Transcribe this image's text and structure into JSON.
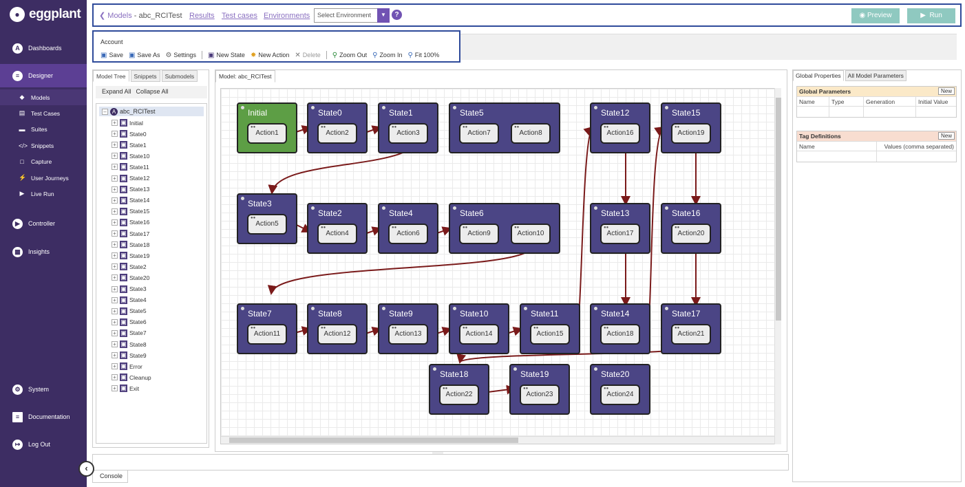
{
  "brand": {
    "name": "eggplant"
  },
  "nav": {
    "main": [
      {
        "label": "Dashboards",
        "icon": "dashboard-icon"
      },
      {
        "label": "Designer",
        "icon": "designer-icon"
      },
      {
        "label": "Controller",
        "icon": "controller-icon"
      },
      {
        "label": "Insights",
        "icon": "insights-icon"
      }
    ],
    "sub": [
      {
        "label": "Models",
        "icon": "models-icon"
      },
      {
        "label": "Test Cases",
        "icon": "test-cases-icon"
      },
      {
        "label": "Suites",
        "icon": "suites-icon"
      },
      {
        "label": "Snippets",
        "icon": "snippets-icon"
      },
      {
        "label": "Capture",
        "icon": "capture-icon"
      },
      {
        "label": "User Journeys",
        "icon": "user-journeys-icon"
      },
      {
        "label": "Live Run",
        "icon": "live-run-icon"
      }
    ],
    "bottom": [
      {
        "label": "System",
        "icon": "system-icon"
      },
      {
        "label": "Documentation",
        "icon": "documentation-icon"
      },
      {
        "label": "Log Out",
        "icon": "logout-icon"
      }
    ]
  },
  "topbar": {
    "crumb_parent": "Models",
    "crumb_sep": " - ",
    "crumb_current": "abc_RCITest",
    "links": [
      "Results",
      "Test cases",
      "Environments"
    ],
    "env_placeholder": "Select Environment",
    "preview_label": "Preview",
    "run_label": "Run"
  },
  "toolbar": {
    "account": "Account",
    "save": "Save",
    "save_as": "Save As",
    "settings": "Settings",
    "new_state": "New State",
    "new_action": "New Action",
    "delete": "Delete",
    "zoom_out": "Zoom Out",
    "zoom_in": "Zoom In",
    "fit": "Fit 100%"
  },
  "left_panel": {
    "tabs": [
      "Model Tree",
      "Snippets",
      "Submodels"
    ],
    "expand_all": "Expand All",
    "collapse_all": "Collapse All",
    "root": "abc_RCITest",
    "nodes": [
      "Initial",
      "State0",
      "State1",
      "State10",
      "State11",
      "State12",
      "State13",
      "State14",
      "State15",
      "State16",
      "State17",
      "State18",
      "State19",
      "State2",
      "State20",
      "State3",
      "State4",
      "State5",
      "State6",
      "State7",
      "State8",
      "State9",
      "Error",
      "Cleanup",
      "Exit"
    ]
  },
  "canvas": {
    "tab": "Model: abc_RCITest",
    "states": [
      {
        "name": "Initial",
        "actions": [
          "Action1"
        ],
        "kind": "initial"
      },
      {
        "name": "State0",
        "actions": [
          "Action2"
        ]
      },
      {
        "name": "State1",
        "actions": [
          "Action3"
        ]
      },
      {
        "name": "State5",
        "actions": [
          "Action7",
          "Action8"
        ]
      },
      {
        "name": "State12",
        "actions": [
          "Action16"
        ]
      },
      {
        "name": "State15",
        "actions": [
          "Action19"
        ]
      },
      {
        "name": "State3",
        "actions": [
          "Action5"
        ]
      },
      {
        "name": "State2",
        "actions": [
          "Action4"
        ]
      },
      {
        "name": "State4",
        "actions": [
          "Action6"
        ]
      },
      {
        "name": "State6",
        "actions": [
          "Action9",
          "Action10"
        ]
      },
      {
        "name": "State13",
        "actions": [
          "Action17"
        ]
      },
      {
        "name": "State16",
        "actions": [
          "Action20"
        ]
      },
      {
        "name": "State7",
        "actions": [
          "Action11"
        ]
      },
      {
        "name": "State8",
        "actions": [
          "Action12"
        ]
      },
      {
        "name": "State9",
        "actions": [
          "Action13"
        ]
      },
      {
        "name": "State10",
        "actions": [
          "Action14"
        ]
      },
      {
        "name": "State11",
        "actions": [
          "Action15"
        ]
      },
      {
        "name": "State14",
        "actions": [
          "Action18"
        ]
      },
      {
        "name": "State17",
        "actions": [
          "Action21"
        ]
      },
      {
        "name": "State18",
        "actions": [
          "Action22"
        ]
      },
      {
        "name": "State19",
        "actions": [
          "Action23"
        ]
      },
      {
        "name": "State20",
        "actions": [
          "Action24"
        ]
      }
    ]
  },
  "right_panel": {
    "tabs": [
      "Global Properties",
      "All Model Parameters"
    ],
    "global_params": {
      "title": "Global Parameters",
      "new": "New",
      "cols": [
        "Name",
        "Type",
        "Generation",
        "Initial Value"
      ]
    },
    "tag_defs": {
      "title": "Tag Definitions",
      "new": "New",
      "cols": [
        "Name",
        "Values (comma separated)"
      ]
    }
  },
  "console": {
    "tab": "Console"
  },
  "colors": {
    "sidebar": "#3d2d63",
    "accent": "#7153b3",
    "state": "#4b4585",
    "initial": "#5d9e45",
    "wire": "#7a1a1a",
    "run": "#8fc9c0"
  }
}
